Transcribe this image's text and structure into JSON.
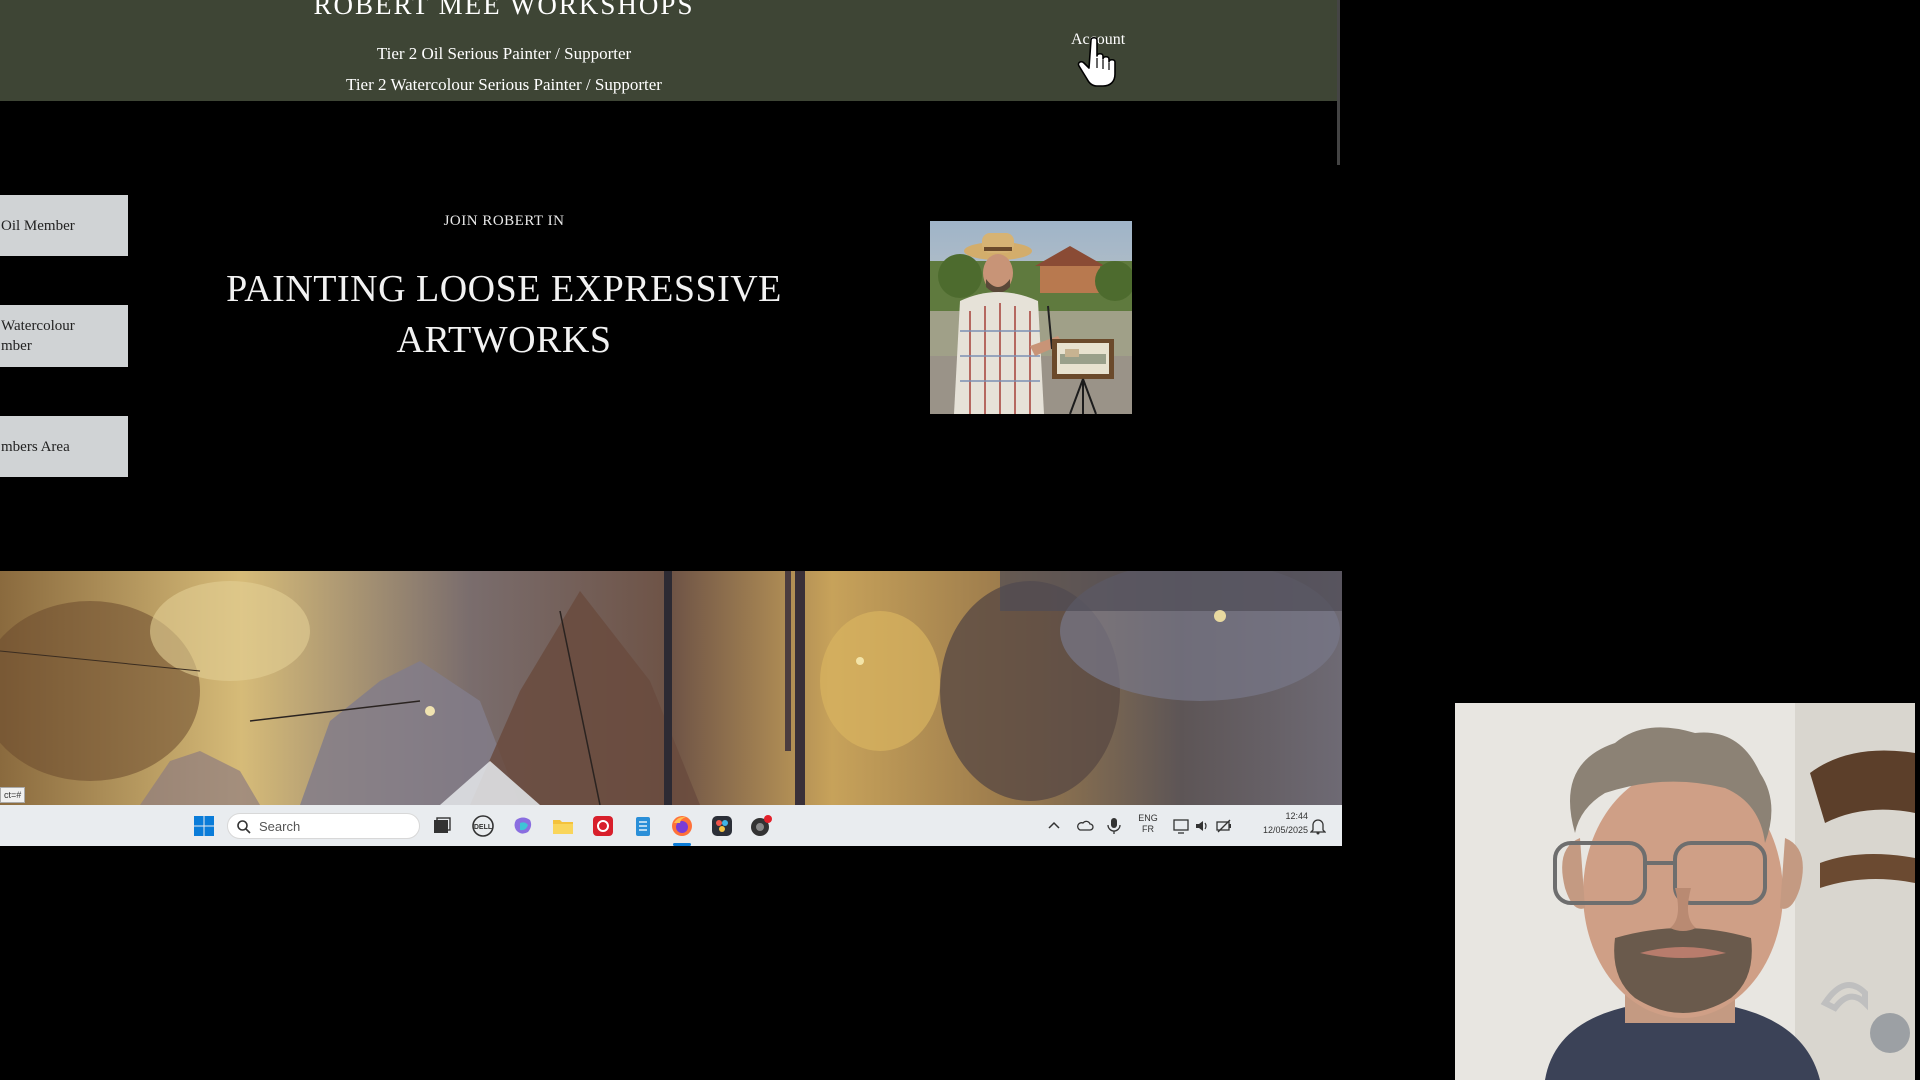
{
  "header": {
    "site_title": "ROBERT MEE WORKSHOPS",
    "tier_links": [
      "Tier 2 Oil Serious Painter / Supporter",
      "Tier 2 Watercolour Serious Painter / Supporter"
    ],
    "account_label": "Account"
  },
  "sidebar": {
    "buttons": [
      "Oil Member",
      "Watercolour\nmber",
      "mbers Area"
    ]
  },
  "hero": {
    "kicker": "JOIN ROBERT IN",
    "headline_line1": "PAINTING LOOSE EXPRESSIVE",
    "headline_line2": "ARTWORKS"
  },
  "status_bar": {
    "url_fragment": "ct=#"
  },
  "taskbar": {
    "search_placeholder": "Search",
    "pinned_icons": [
      "windows-start-icon",
      "task-view-icon",
      "dell-icon",
      "copilot-icon",
      "file-explorer-icon",
      "app-red-icon",
      "notepad-icon",
      "firefox-icon",
      "davinci-resolve-icon",
      "app-badge-icon"
    ],
    "tray": {
      "language": "ENG",
      "keyboard": "FR",
      "time": "12:44",
      "date": "12/05/2025"
    }
  },
  "colors": {
    "header_bg": "#3e4535",
    "page_bg": "#000000",
    "button_bg": "#d0d3d5",
    "taskbar_bg": "#e9ecef"
  }
}
